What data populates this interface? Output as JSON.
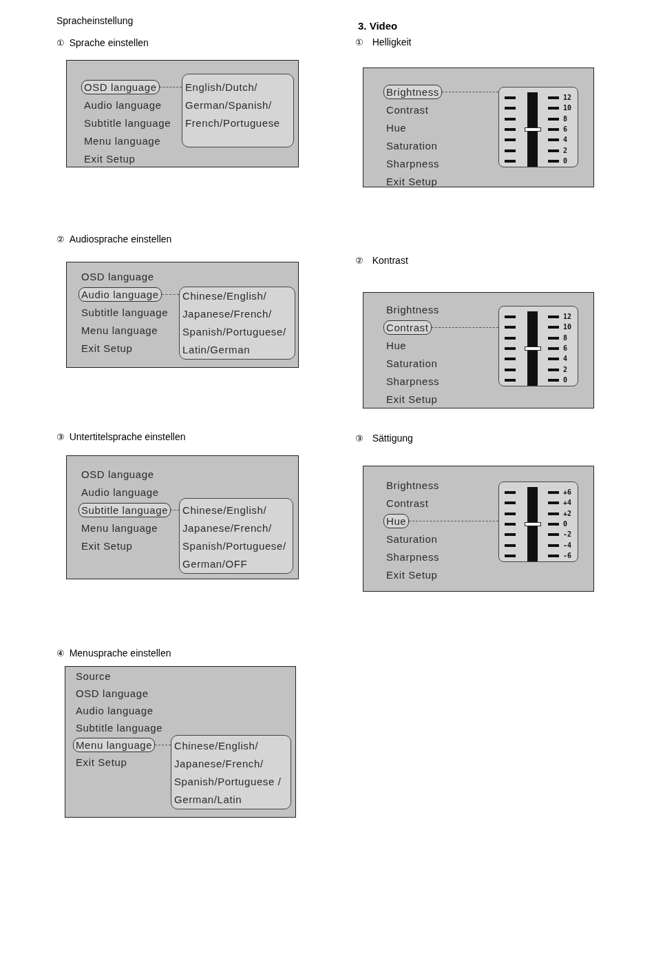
{
  "columns": [
    {
      "heading": {
        "kind": "plain",
        "text": "Spracheinstellung"
      },
      "steps": [
        {
          "number": "①",
          "title": "Sprache einstellen",
          "menu": {
            "items": [
              {
                "label": "OSD language",
                "selected": true
              },
              {
                "label": "Audio language",
                "selected": false
              },
              {
                "label": "Subtitle language",
                "selected": false
              },
              {
                "label": "Menu language",
                "selected": false
              },
              {
                "label": "Exit Setup",
                "selected": false
              }
            ],
            "popup": {
              "kind": "list",
              "lines": [
                "English/Dutch/",
                "German/Spanish/",
                "French/Portuguese"
              ]
            }
          }
        },
        {
          "number": "②",
          "title": "Audiosprache einstellen",
          "menu": {
            "items": [
              {
                "label": "OSD language",
                "selected": false
              },
              {
                "label": "Audio language",
                "selected": true
              },
              {
                "label": "Subtitle language",
                "selected": false
              },
              {
                "label": "Menu language",
                "selected": false
              },
              {
                "label": "Exit Setup",
                "selected": false
              }
            ],
            "popup": {
              "kind": "list",
              "lines": [
                "Chinese/English/",
                "Japanese/French/",
                "Spanish/Portuguese/",
                "Latin/German"
              ]
            }
          }
        },
        {
          "number": "③",
          "title": "Untertitelsprache einstellen",
          "menu": {
            "items": [
              {
                "label": "OSD language",
                "selected": false
              },
              {
                "label": "Audio language",
                "selected": false
              },
              {
                "label": "Subtitle language",
                "selected": true
              },
              {
                "label": "Menu language",
                "selected": false
              },
              {
                "label": "Exit Setup",
                "selected": false
              }
            ],
            "popup": {
              "kind": "list",
              "lines": [
                "Chinese/English/",
                "Japanese/French/",
                "Spanish/Portuguese/",
                "German/OFF"
              ]
            }
          }
        },
        {
          "number": "④",
          "title": "Menusprache einstellen",
          "menu": {
            "items": [
              {
                "label": "Source",
                "selected": false
              },
              {
                "label": "OSD language",
                "selected": false
              },
              {
                "label": "Audio language",
                "selected": false
              },
              {
                "label": "Subtitle language",
                "selected": false
              },
              {
                "label": "Menu language",
                "selected": true
              },
              {
                "label": "Exit Setup",
                "selected": false
              }
            ],
            "popup": {
              "kind": "list",
              "lines": [
                "Chinese/English/",
                "Japanese/French/",
                "Spanish/Portuguese /",
                "German/Latin"
              ]
            }
          }
        }
      ]
    },
    {
      "heading": {
        "kind": "bold",
        "text": "3. Video"
      },
      "steps": [
        {
          "number": "①",
          "title": "Helligkeit",
          "menu": {
            "items": [
              {
                "label": "Brightness",
                "selected": true
              },
              {
                "label": "Contrast",
                "selected": false
              },
              {
                "label": "Hue",
                "selected": false
              },
              {
                "label": "Saturation",
                "selected": false
              },
              {
                "label": "Sharpness",
                "selected": false
              },
              {
                "label": "Exit Setup",
                "selected": false
              }
            ],
            "popup": {
              "kind": "slider",
              "level": 0.5,
              "scale": [
                "12",
                "10",
                "8",
                "6",
                "4",
                "2",
                "0"
              ]
            }
          }
        },
        {
          "number": "②",
          "title": "Kontrast",
          "menu": {
            "items": [
              {
                "label": "Brightness",
                "selected": false
              },
              {
                "label": "Contrast",
                "selected": true
              },
              {
                "label": "Hue",
                "selected": false
              },
              {
                "label": "Saturation",
                "selected": false
              },
              {
                "label": "Sharpness",
                "selected": false
              },
              {
                "label": "Exit Setup",
                "selected": false
              }
            ],
            "popup": {
              "kind": "slider",
              "level": 0.5,
              "scale": [
                "12",
                "10",
                "8",
                "6",
                "4",
                "2",
                "0"
              ]
            }
          }
        },
        {
          "number": "③",
          "title": "Sättigung",
          "menu": {
            "items": [
              {
                "label": "Brightness",
                "selected": false
              },
              {
                "label": "Contrast",
                "selected": false
              },
              {
                "label": "Hue",
                "selected": true
              },
              {
                "label": "Saturation",
                "selected": false
              },
              {
                "label": "Sharpness",
                "selected": false
              },
              {
                "label": "Exit Setup",
                "selected": false
              }
            ],
            "popup": {
              "kind": "slider",
              "level": 0.5,
              "scale": [
                "+6",
                "+4",
                "+2",
                "0",
                "-2",
                "-4",
                "-6"
              ]
            }
          }
        }
      ]
    }
  ]
}
